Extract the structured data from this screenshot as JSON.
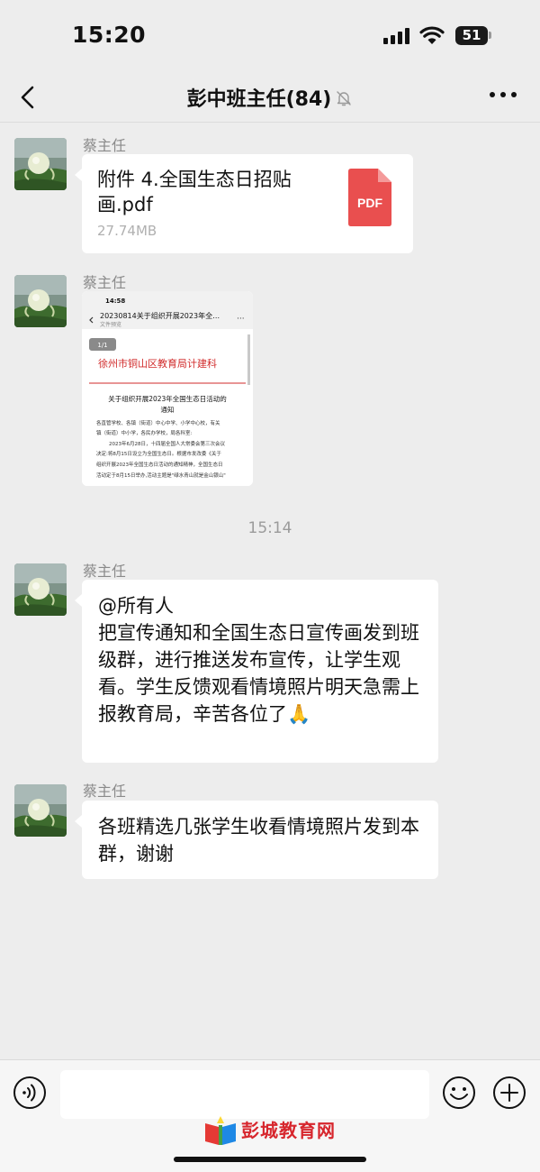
{
  "status_bar": {
    "time": "15:20",
    "battery": "51"
  },
  "nav": {
    "title": "彭中班主任(84)"
  },
  "messages": [
    {
      "sender": "蔡主任",
      "type": "file",
      "file_name": "附件 4.全国生态日招贴画.pdf",
      "file_size": "27.74MB",
      "file_badge": "PDF"
    },
    {
      "sender": "蔡主任",
      "type": "doc_preview",
      "preview": {
        "phone_time": "14:58",
        "title": "20230814关于组织开展2023年全…",
        "subtitle": "文件预览",
        "page_indicator": "1/1",
        "org": "徐州市铜山区教育局计建科",
        "doc_title_1": "关于组织开展2023年全国生态日活动的",
        "doc_title_2": "通知",
        "lines": [
          "各直管学校、各镇（街道）中心中学、小学中心校，有关",
          "镇（街道）中小学，各民办学校，局各科室:",
          "2023年6月28日，十四届全国人大常委会第三次会议",
          "决定:将8月15日设立为全国生态日。根据市发改委《关于",
          "组织开展2023年全国生态日活动的通知精神，全国生态日",
          "活动定于8月15日举办,活动主题是\"绿水青山就是金山银山\""
        ]
      }
    },
    {
      "type": "time",
      "time": "15:14"
    },
    {
      "sender": "蔡主任",
      "type": "text",
      "text": "@所有人\n把宣传通知和全国生态日宣传画发到班级群，进行推送发布宣传，让学生观看。学生反馈观看情境照片明天急需上报教育局，辛苦各位了🙏"
    },
    {
      "sender": "蔡主任",
      "type": "text",
      "text": "各班精选几张学生收看情境照片发到本群，谢谢"
    }
  ],
  "input": {
    "value": "",
    "placeholder": ""
  },
  "watermark": {
    "text": "彭城教育网"
  },
  "icons": [
    "back-arrow-icon",
    "mute-bell-icon",
    "more-icon",
    "pdf-icon",
    "voice-icon",
    "emoji-icon",
    "plus-icon",
    "signal-icon",
    "wifi-icon",
    "battery-icon"
  ]
}
